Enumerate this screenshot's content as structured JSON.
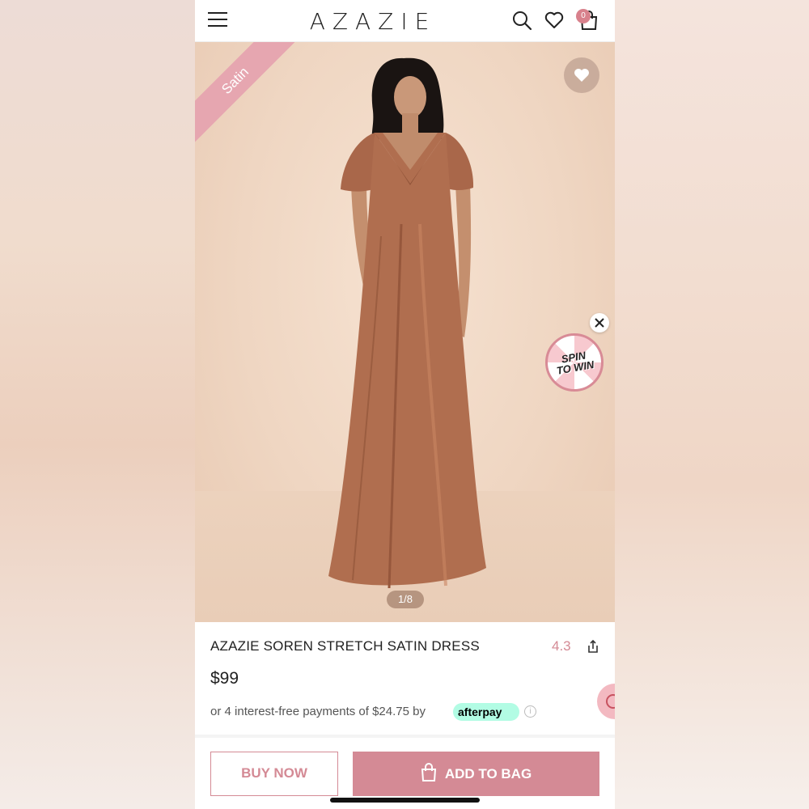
{
  "header": {
    "logo": "AZAZIE",
    "cart_count": "0"
  },
  "hero": {
    "ribbon_label": "Satin",
    "image_counter": "1/8",
    "spin_label_1": "SPIN",
    "spin_label_2": "TO WIN"
  },
  "product": {
    "title": "AZAZIE SOREN STRETCH SATIN DRESS",
    "rating": "4.3",
    "price": "$99",
    "installments_text": "or 4 interest-free payments of $24.75 by",
    "afterpay_label": "afterpay"
  },
  "actions": {
    "buy_now": "BUY NOW",
    "add_to_bag": "ADD TO BAG"
  },
  "colors": {
    "accent": "#d48a95",
    "dress": "#b06e4f",
    "afterpay": "#b2fce4"
  }
}
